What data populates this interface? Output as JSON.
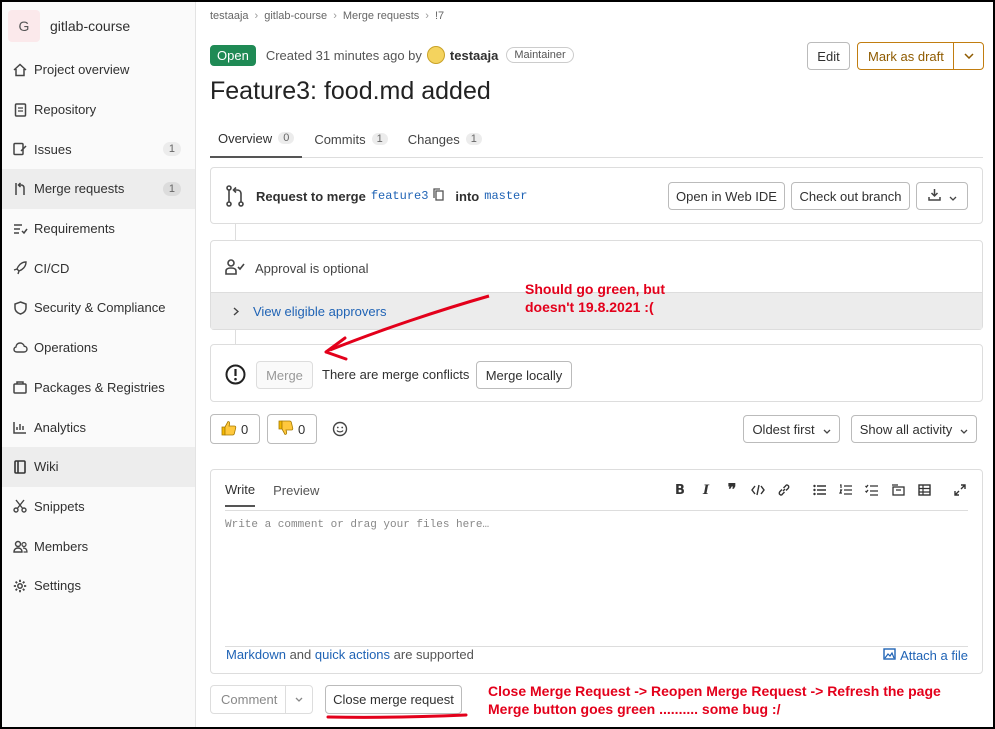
{
  "project": {
    "avatar_letter": "G",
    "name": "gitlab-course"
  },
  "sidebar": {
    "items": [
      {
        "label": "Project overview",
        "icon": "home-icon",
        "count": ""
      },
      {
        "label": "Repository",
        "icon": "doc-icon",
        "count": ""
      },
      {
        "label": "Issues",
        "icon": "issues-icon",
        "count": "1"
      },
      {
        "label": "Merge requests",
        "icon": "merge-request-icon",
        "count": "1"
      },
      {
        "label": "Requirements",
        "icon": "requirements-icon",
        "count": ""
      },
      {
        "label": "CI/CD",
        "icon": "rocket-icon",
        "count": ""
      },
      {
        "label": "Security & Compliance",
        "icon": "shield-icon",
        "count": ""
      },
      {
        "label": "Operations",
        "icon": "cloud-icon",
        "count": ""
      },
      {
        "label": "Packages & Registries",
        "icon": "package-icon",
        "count": ""
      },
      {
        "label": "Analytics",
        "icon": "chart-icon",
        "count": ""
      },
      {
        "label": "Wiki",
        "icon": "book-icon",
        "count": ""
      },
      {
        "label": "Snippets",
        "icon": "scissors-icon",
        "count": ""
      },
      {
        "label": "Members",
        "icon": "users-icon",
        "count": ""
      },
      {
        "label": "Settings",
        "icon": "gear-icon",
        "count": ""
      }
    ]
  },
  "breadcrumb": [
    "testaaja",
    "gitlab-course",
    "Merge requests",
    "!7"
  ],
  "mr": {
    "status": "Open",
    "created": "Created 31 minutes ago by",
    "author": "testaaja",
    "role": "Maintainer",
    "edit_label": "Edit",
    "draft_label": "Mark as draft",
    "title": "Feature3: food.md added"
  },
  "tabs": [
    {
      "label": "Overview",
      "count": "0"
    },
    {
      "label": "Commits",
      "count": "1"
    },
    {
      "label": "Changes",
      "count": "1"
    }
  ],
  "merge_info": {
    "request_label": "Request to merge",
    "source_branch": "feature3",
    "into_label": "into",
    "target_branch": "master",
    "web_ide_label": "Open in Web IDE",
    "checkout_label": "Check out branch"
  },
  "approval": {
    "text": "Approval is optional",
    "eligible_label": "View eligible approvers"
  },
  "merge_widget": {
    "merge_label": "Merge",
    "conflict_text": "There are merge conflicts",
    "merge_locally_label": "Merge locally"
  },
  "reactions": {
    "thumbs_up": "0",
    "thumbs_down": "0"
  },
  "discussion": {
    "sort_label": "Oldest first",
    "filter_label": "Show all activity"
  },
  "comment": {
    "write_tab": "Write",
    "preview_tab": "Preview",
    "placeholder": "Write a comment or drag your files here…",
    "markdown_link": "Markdown",
    "and_text": " and ",
    "quick_actions_link": "quick actions",
    "supported_text": " are supported",
    "attach_label": "Attach a file",
    "comment_button": "Comment",
    "close_button": "Close merge request"
  },
  "annotations": {
    "note1_line1": "Should go green, but",
    "note1_line2": "doesn't 19.8.2021 :(",
    "note2_line1": "Close Merge Request -> Reopen Merge Request -> Refresh the page",
    "note2_line2": "Merge button goes green .......... some bug :/",
    "color": "#e3001b"
  }
}
